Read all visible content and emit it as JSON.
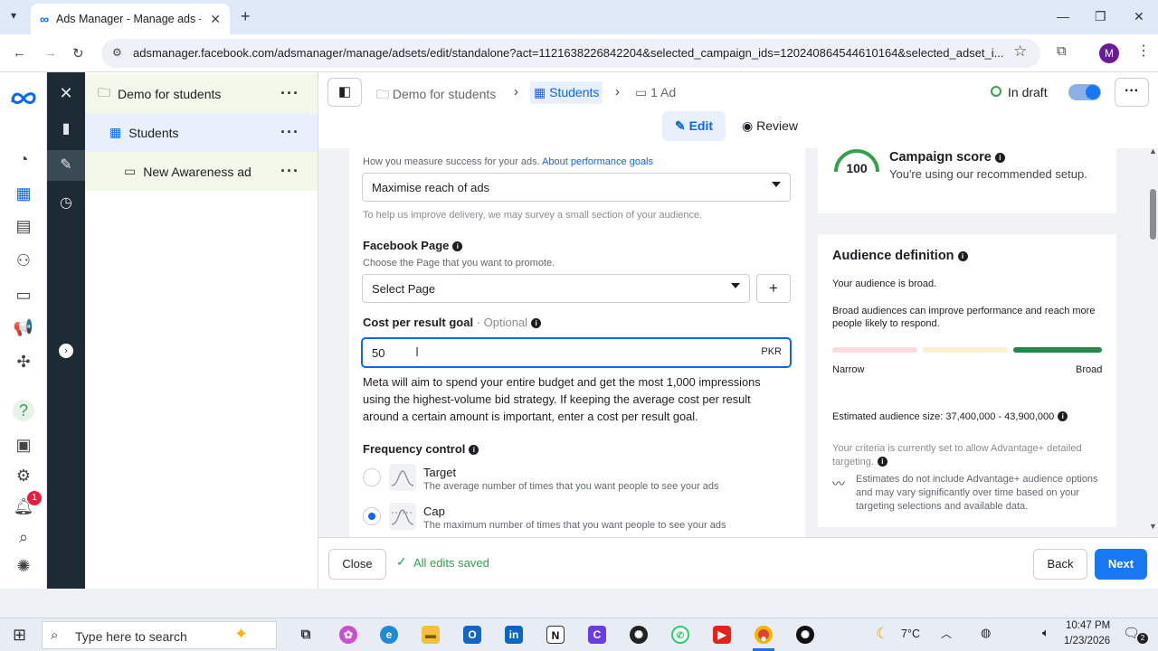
{
  "browser": {
    "tab_title": "Ads Manager - Manage ads - A",
    "url": "adsmanager.facebook.com/adsmanager/manage/adsets/edit/standalone?act=1121638226842204&selected_campaign_ids=120240864544610164&selected_adset_i...",
    "profile_initial": "M"
  },
  "tree": {
    "campaign": "Demo for students",
    "adset": "Students",
    "ad": "New Awareness ad"
  },
  "header": {
    "crumb_campaign": "Demo for students",
    "crumb_adset": "Students",
    "crumb_ad": "1 Ad",
    "status": "In draft",
    "edit_label": "Edit",
    "review_label": "Review"
  },
  "form": {
    "perf_goal_help": "How you measure success for your ads.",
    "perf_goal_link": "About performance goals",
    "perf_goal_value": "Maximise reach of ads",
    "survey_note": "To help us improve delivery, we may survey a small section of your audience.",
    "fb_page_label": "Facebook Page",
    "fb_page_help": "Choose the Page that you want to promote.",
    "fb_page_placeholder": "Select Page",
    "cost_label": "Cost per result goal",
    "cost_optional": "· Optional",
    "cost_value": "50",
    "cost_currency": "PKR",
    "cost_desc": "Meta will aim to spend your entire budget and get the most 1,000 impressions using the highest-volume bid strategy. If keeping the average cost per result around a certain amount is important, enter a cost per result goal.",
    "freq_label": "Frequency control",
    "freq_target_title": "Target",
    "freq_target_desc": "The average number of times that you want people to see your ads",
    "freq_cap_title": "Cap",
    "freq_cap_desc": "The maximum number of times that you want people to see your ads",
    "freq_selected": "Cap"
  },
  "score": {
    "value": "100",
    "title": "Campaign score",
    "subtitle": "You're using our recommended setup."
  },
  "audience": {
    "title": "Audience definition",
    "broad_text": "Your audience is broad.",
    "broad_desc": "Broad audiences can improve performance and reach more people likely to respond.",
    "narrow": "Narrow",
    "broad": "Broad",
    "estimated": "Estimated audience size: 37,400,000 - 43,900,000",
    "criteria": "Your criteria is currently set to allow Advantage+ detailed targeting.",
    "estimates_note": "Estimates do not include Advantage+ audience options and may vary significantly over time based on your targeting selections and available data."
  },
  "footer": {
    "close": "Close",
    "saved": "All edits saved",
    "back": "Back",
    "next": "Next"
  },
  "taskbar": {
    "search_placeholder": "Type here to search",
    "weather": "7°C",
    "time": "10:47 PM",
    "date": "1/23/2026",
    "notification_count": "2",
    "nav_badge": "1"
  },
  "colors": {
    "accent": "#0866ff",
    "dark_strip": "#1c2b33",
    "score_green": "#31a24c",
    "next_button": "#1877f2"
  }
}
